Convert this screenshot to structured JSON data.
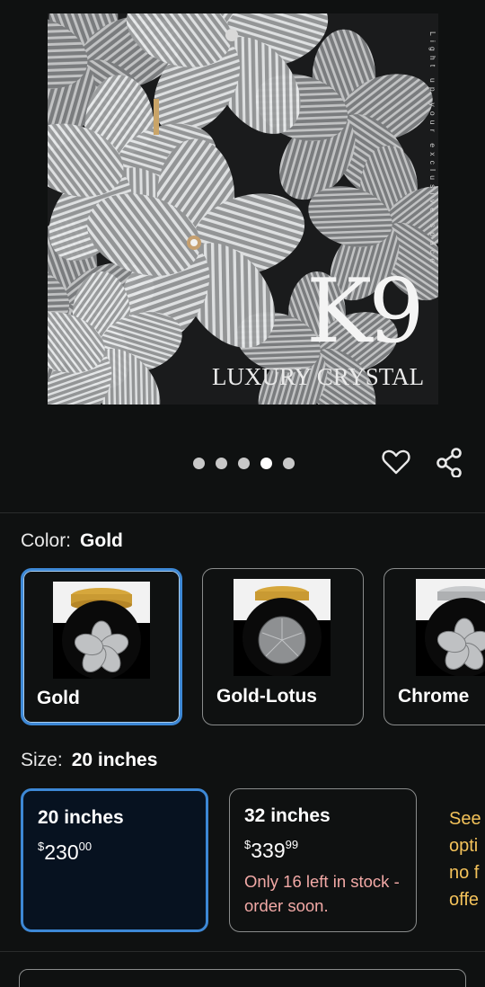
{
  "hero": {
    "brand_title": "K9",
    "brand_subtitle": "LUXURY CRYSTAL",
    "vertical_tagline": "Light up your exclusive space",
    "carousel": {
      "count": 5,
      "active_index": 3
    }
  },
  "actions": {
    "favorite_icon": "heart-outline-icon",
    "share_icon": "share-icon"
  },
  "color": {
    "label": "Color:",
    "selected": "Gold",
    "options": [
      {
        "name": "Gold",
        "selected": true
      },
      {
        "name": "Gold-Lotus",
        "selected": false
      },
      {
        "name": "Chrome",
        "selected": false
      }
    ]
  },
  "size": {
    "label": "Size:",
    "selected": "20 inches",
    "options": [
      {
        "name": "20 inches",
        "currency": "$",
        "whole": "230",
        "fraction": "00",
        "stock": "",
        "selected": true
      },
      {
        "name": "32 inches",
        "currency": "$",
        "whole": "339",
        "fraction": "99",
        "stock": "Only 16 left in stock - order soon.",
        "selected": false
      }
    ],
    "see_more": [
      "See",
      "opti",
      "no f",
      "offe"
    ]
  },
  "colors": {
    "accent": "#3d88d6",
    "warning": "#f2a9a6",
    "link": "#f3c25a",
    "background": "#0f1111"
  }
}
